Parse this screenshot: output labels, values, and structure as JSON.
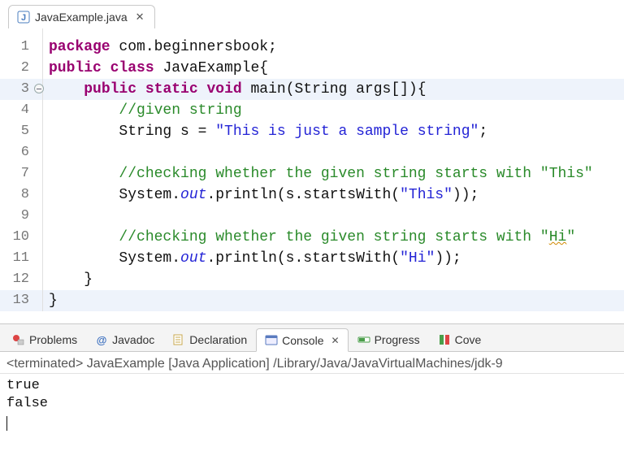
{
  "editor_tab": {
    "filename": "JavaExample.java"
  },
  "code": {
    "lines": [
      {
        "n": "1",
        "indent": "",
        "tokens": [
          [
            "kw",
            "package"
          ],
          [
            "pln",
            " com.beginnersbook;"
          ]
        ]
      },
      {
        "n": "2",
        "indent": "",
        "tokens": [
          [
            "kw",
            "public"
          ],
          [
            "pln",
            " "
          ],
          [
            "kw",
            "class"
          ],
          [
            "pln",
            " JavaExample{"
          ]
        ]
      },
      {
        "n": "3",
        "fold": true,
        "hl": true,
        "indent": "    ",
        "tokens": [
          [
            "kw",
            "public"
          ],
          [
            "pln",
            " "
          ],
          [
            "kw",
            "static"
          ],
          [
            "pln",
            " "
          ],
          [
            "kw",
            "void"
          ],
          [
            "pln",
            " main(String args[]){"
          ]
        ]
      },
      {
        "n": "4",
        "indent": "        ",
        "tokens": [
          [
            "com",
            "//given string"
          ]
        ]
      },
      {
        "n": "5",
        "indent": "        ",
        "tokens": [
          [
            "pln",
            "String s = "
          ],
          [
            "str",
            "\"This is just a sample string\""
          ],
          [
            "pln",
            ";"
          ]
        ]
      },
      {
        "n": "6",
        "indent": "",
        "tokens": []
      },
      {
        "n": "7",
        "indent": "        ",
        "tokens": [
          [
            "com",
            "//checking whether the given string starts with \"This\""
          ]
        ]
      },
      {
        "n": "8",
        "indent": "        ",
        "tokens": [
          [
            "pln",
            "System."
          ],
          [
            "field-italic",
            "out"
          ],
          [
            "pln",
            ".println(s.startsWith("
          ],
          [
            "str",
            "\"This\""
          ],
          [
            "pln",
            "));"
          ]
        ]
      },
      {
        "n": "9",
        "indent": "",
        "tokens": []
      },
      {
        "n": "10",
        "indent": "        ",
        "tokens": [
          [
            "com",
            "//checking whether the given string starts with \""
          ],
          [
            "com spellerr",
            "Hi"
          ],
          [
            "com",
            "\""
          ]
        ]
      },
      {
        "n": "11",
        "indent": "        ",
        "tokens": [
          [
            "pln",
            "System."
          ],
          [
            "field-italic",
            "out"
          ],
          [
            "pln",
            ".println(s.startsWith("
          ],
          [
            "str",
            "\"Hi\""
          ],
          [
            "pln",
            "));"
          ]
        ]
      },
      {
        "n": "12",
        "indent": "    ",
        "tokens": [
          [
            "pln",
            "}"
          ]
        ]
      },
      {
        "n": "13",
        "hl": true,
        "indent": "",
        "tokens": [
          [
            "pln",
            "}"
          ]
        ]
      }
    ]
  },
  "bottom_tabs": {
    "problems": "Problems",
    "javadoc": "Javadoc",
    "declaration": "Declaration",
    "console": "Console",
    "progress": "Progress",
    "coverage": "Cove"
  },
  "console": {
    "status": "<terminated> JavaExample [Java Application] /Library/Java/JavaVirtualMachines/jdk-9",
    "lines": [
      "true",
      "false"
    ]
  }
}
